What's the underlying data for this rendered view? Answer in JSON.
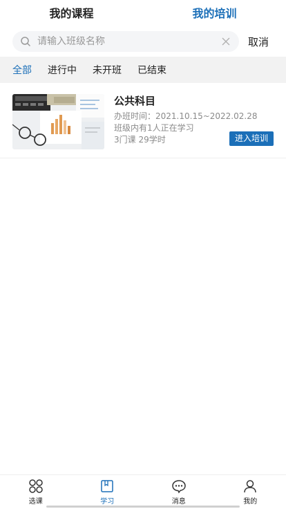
{
  "top_tabs": [
    {
      "label": "我的课程",
      "active": false
    },
    {
      "label": "我的培训",
      "active": true
    }
  ],
  "search": {
    "placeholder": "请输入班级名称",
    "value": "",
    "cancel_label": "取消"
  },
  "filters": [
    {
      "label": "全部",
      "active": true
    },
    {
      "label": "进行中",
      "active": false
    },
    {
      "label": "未开班",
      "active": false
    },
    {
      "label": "已结束",
      "active": false
    }
  ],
  "courses": [
    {
      "title": "公共科目",
      "time": "办班时间：2021.10.15~2022.02.28",
      "learners": "班级内有1人正在学习",
      "stats": "3门课 29学时",
      "action_label": "进入培训"
    }
  ],
  "bottom_nav": [
    {
      "label": "选课",
      "icon": "grid-icon",
      "active": false
    },
    {
      "label": "学习",
      "icon": "book-icon",
      "active": true
    },
    {
      "label": "消息",
      "icon": "chat-icon",
      "active": false
    },
    {
      "label": "我的",
      "icon": "user-icon",
      "active": false
    }
  ],
  "colors": {
    "accent": "#1b6fb8",
    "filter_bg": "#f2f2f2",
    "search_bg": "#f4f5f7"
  }
}
